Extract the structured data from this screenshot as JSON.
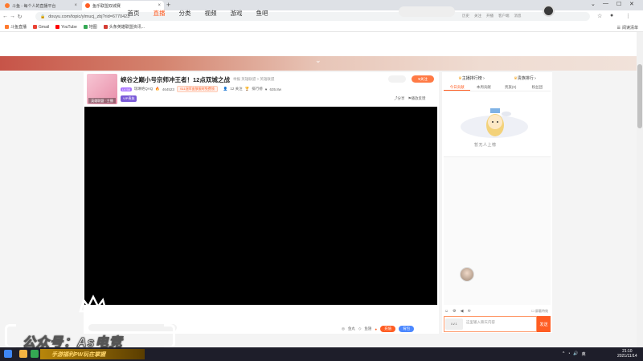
{
  "browser": {
    "tabs": [
      {
        "title": "斗鱼 - 每个人的直播平台",
        "active": false,
        "color": "#ff7a2f"
      },
      {
        "title": "鱼乐联盟双城赛",
        "active": true,
        "color": "#ff5d23"
      }
    ],
    "new_tab": "+",
    "url": "douyu.com/topic/ylmucj_zbj?rid=6770423",
    "bookmarks": [
      {
        "label": "斗鱼直播",
        "color": "#ff7a2f"
      },
      {
        "label": "Gmail",
        "color": "#ea4335"
      },
      {
        "label": "YouTube",
        "color": "#ff0000"
      },
      {
        "label": "地图",
        "color": "#34a853"
      },
      {
        "label": "头条英雄联盟资讯...",
        "color": "#d43c33"
      }
    ],
    "reading_list": "阅读清单"
  },
  "site": {
    "nav": [
      {
        "label": "首页",
        "active": false
      },
      {
        "label": "直播",
        "active": true
      },
      {
        "label": "分类",
        "active": false
      },
      {
        "label": "视频",
        "active": false
      },
      {
        "label": "游戏",
        "active": false
      },
      {
        "label": "鱼吧",
        "active": false
      }
    ],
    "header_links": [
      "历史",
      "关注",
      "开播",
      "客户端",
      "消息"
    ]
  },
  "room": {
    "title": "峡谷之巅小号宗师冲王者！12点双城之战",
    "category": "举报",
    "subtitle": "英雄联盟 > 英雄联盟",
    "level": "LV.58",
    "host": "瑞琳绝QAQ",
    "hot_count": "464523",
    "event_tag": "S11冠军皮肤限时免费领",
    "viewers_label": "12 关注",
    "fans_label": "排行榜",
    "rank_label": "635.8w",
    "vip_label": "VIP贵族",
    "cover_tag": "英雄联盟 · 主播",
    "follow_label": "关注",
    "share_label": "分享",
    "report_label": "播放反馈"
  },
  "bottom_bar": {
    "gift_placeholder": "",
    "fish_label": "鱼丸",
    "pet_label": "鱼翅",
    "btn_orange": "充值",
    "btn_blue": "背包"
  },
  "rank_panel": {
    "head_left": "主播排行榜 ›",
    "head_right": "贵族排行 ›",
    "tabs": [
      {
        "label": "今日贡献",
        "active": true
      },
      {
        "label": "本周贡献",
        "active": false
      },
      {
        "label": "贵族(0)",
        "active": false
      },
      {
        "label": "粉丝团",
        "active": false
      }
    ],
    "empty_text": "暂无人上榜",
    "block_label": "屏蔽特效",
    "chat_level": "LV.1",
    "chat_placeholder": "这里输入聊天内容",
    "send_label": "发送"
  },
  "watermark": {
    "text": "公众号：As电竞"
  },
  "taskbar": {
    "promo": "手游福利PW玩在掌握",
    "time": "21:10",
    "date": "2021/11/14"
  }
}
